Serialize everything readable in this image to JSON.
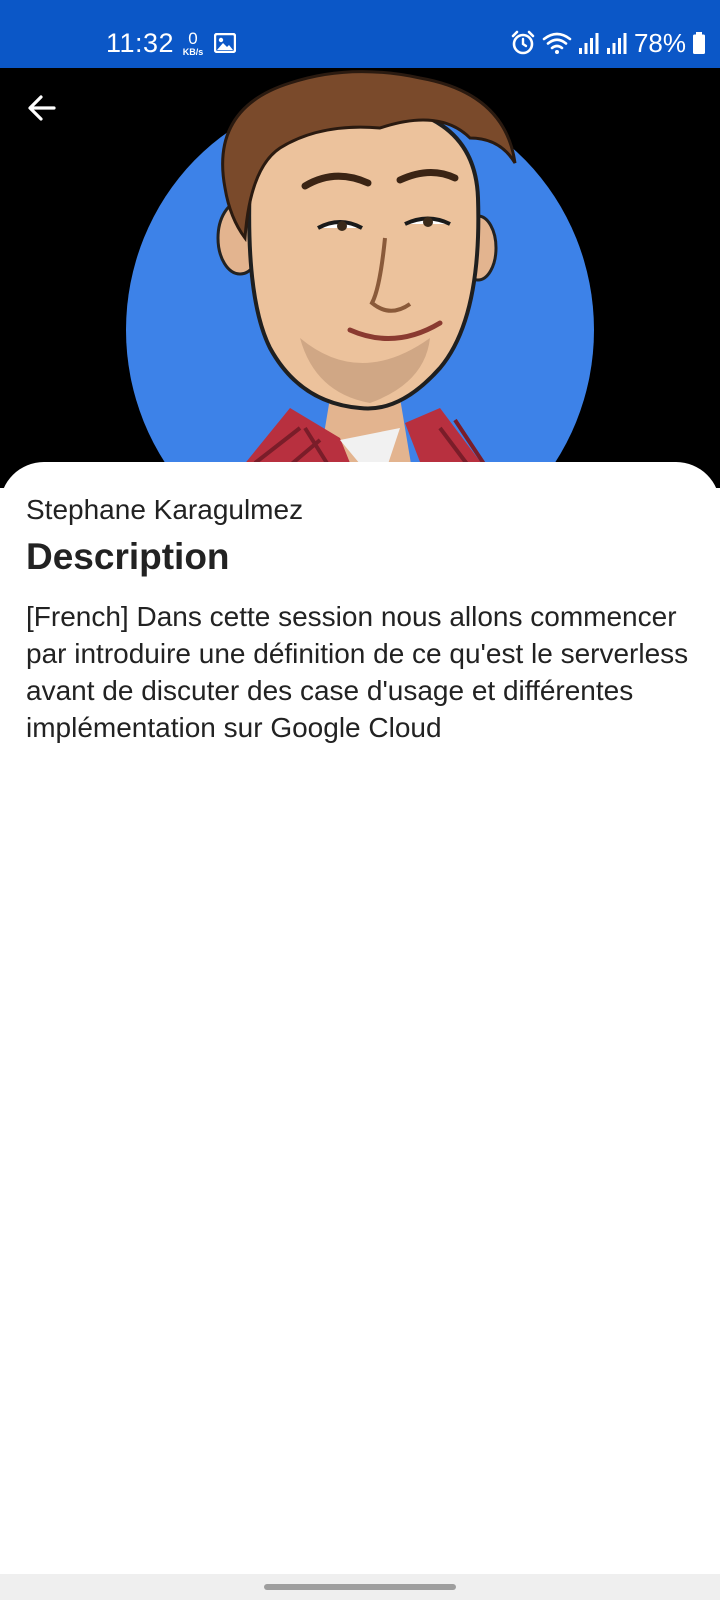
{
  "status_bar": {
    "time": "11:32",
    "network_speed_value": "0",
    "network_speed_unit": "KB/s",
    "battery": "78%",
    "background_color": "#0b57c7",
    "icons": [
      "gallery-icon",
      "alarm-icon",
      "wifi-icon",
      "signal-icon",
      "signal-icon",
      "battery-icon"
    ]
  },
  "header": {
    "back_icon": "arrow-left-icon",
    "image_background": "#000000",
    "avatar_circle_color": "#3d82e8"
  },
  "session": {
    "speaker_name": "Stephane Karagulmez",
    "section_title": "Description",
    "description": "[French] Dans cette session nous allons commencer par introduire une définition de ce qu'est le serverless avant de discuter des case d'usage et différentes implémentation sur Google Cloud"
  }
}
